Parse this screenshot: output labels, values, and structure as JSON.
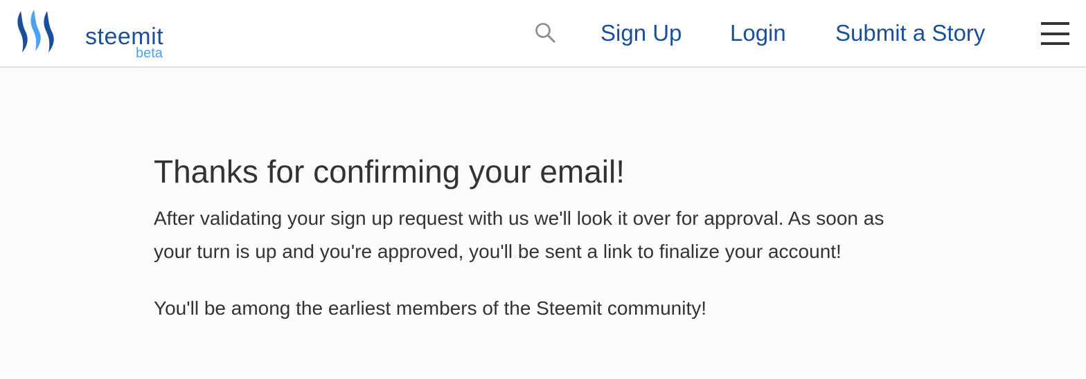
{
  "header": {
    "brand": {
      "name": "steemit",
      "tag": "beta"
    },
    "nav": {
      "search_icon": "search-icon",
      "signup_label": "Sign Up",
      "login_label": "Login",
      "submit_label": "Submit a Story",
      "menu_icon": "hamburger-menu-icon"
    }
  },
  "main": {
    "title": "Thanks for confirming your email!",
    "paragraph_1": "After validating your sign up request with us we'll look it over for approval. As soon as your turn is up and you're approved, you'll be sent a link to finalize your account!",
    "paragraph_2": "You'll be among the earliest members of the Steemit community!"
  },
  "colors": {
    "brand_dark_blue": "#1a5099",
    "brand_light_blue": "#4ba2f2",
    "text": "#333333",
    "background": "#fcfcfc"
  }
}
